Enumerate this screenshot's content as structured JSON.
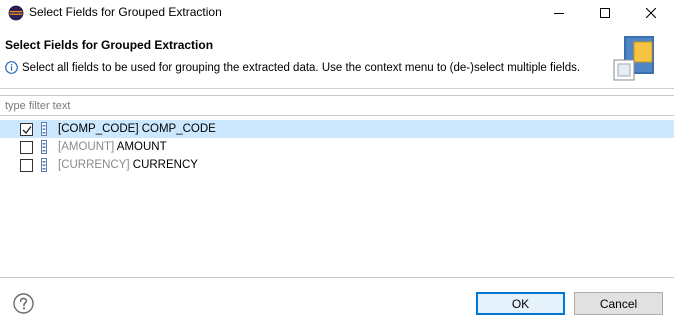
{
  "window": {
    "title": "Select Fields for Grouped Extraction"
  },
  "header": {
    "title": "Select Fields for Grouped Extraction",
    "message": "Select all fields to be used for grouping the extracted data. Use the context menu to (de-)select multiple fields."
  },
  "filter": {
    "placeholder": "type filter text",
    "value": ""
  },
  "fields": [
    {
      "key": "[COMP_CODE]",
      "name": "COMP_CODE",
      "checked": true,
      "selected": true,
      "key_muted": false
    },
    {
      "key": "[AMOUNT]",
      "name": "AMOUNT",
      "checked": false,
      "selected": false,
      "key_muted": true
    },
    {
      "key": "[CURRENCY]",
      "name": "CURRENCY",
      "checked": false,
      "selected": false,
      "key_muted": true
    }
  ],
  "buttons": {
    "ok": "OK",
    "cancel": "Cancel"
  },
  "colors": {
    "selection": "#cce8ff",
    "default_button_border": "#0078d7"
  },
  "icons": {
    "app": "eclipse-icon",
    "info": "info-icon",
    "banner": "wizard-banner-icon",
    "field": "field-icon",
    "help": "help-icon"
  }
}
